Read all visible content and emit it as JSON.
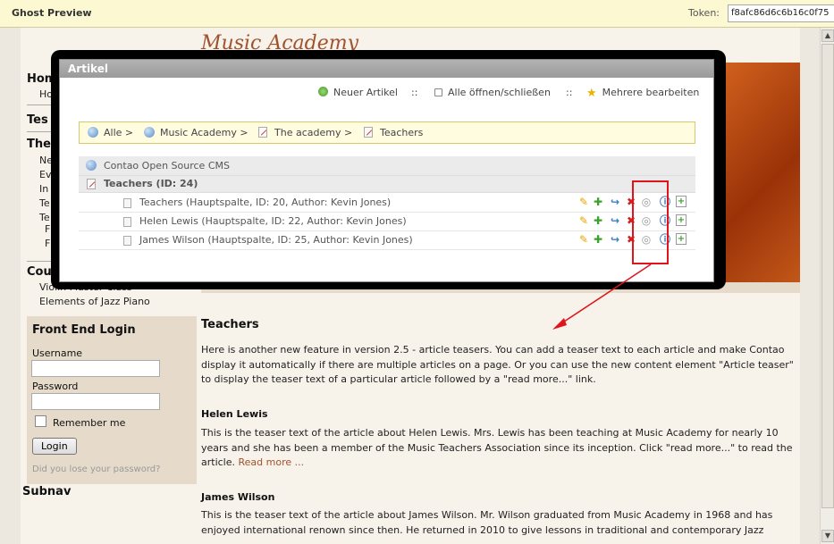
{
  "ghost_bar": {
    "title": "Ghost Preview",
    "token_label": "Token:",
    "token_value": "f8afc86d6c6b16c0f75"
  },
  "site": {
    "logo": "Music Academy"
  },
  "nav": {
    "top_items": [
      {
        "label": "Hom"
      },
      {
        "label": "Tes"
      },
      {
        "label": "The"
      },
      {
        "label": "Cou"
      }
    ],
    "sub_items": [
      "Ho",
      "Ne",
      "Ev",
      "In",
      "Te",
      "Te",
      "F",
      "F"
    ],
    "course_items": [
      "Violin Master Class",
      "Elements of Jazz Piano"
    ]
  },
  "login": {
    "title": "Front End Login",
    "username_label": "Username",
    "password_label": "Password",
    "remember_label": "Remember me",
    "button_label": "Login",
    "lost_password": "Did you lose your password?"
  },
  "subnav": "Subnav",
  "main": {
    "heading": "Teachers",
    "intro": "Here is another new feature in version 2.5 - article teasers. You can add a teaser text to each article and make Contao display it automatically if there are multiple articles on a page. Or you can use the new content element \"Article teaser\" to display the teaser text of a particular article followed by a \"read more...\" link.",
    "articles": [
      {
        "title": "Helen Lewis",
        "text": "This is the teaser text of the article about Helen Lewis. Mrs. Lewis has been teaching at Music Academy for nearly 10 years and she has been a member of the Music Teachers Association since its inception. Click \"read more...\" to read the article.",
        "more": "Read more ..."
      },
      {
        "title": "James Wilson",
        "text": "This is the teaser text of the article about James Wilson. Mr. Wilson graduated from Music Academy in 1968 and has enjoyed international renown since then. He returned in 2010 to give lessons in traditional and contemporary Jazz"
      }
    ]
  },
  "artikel": {
    "title": "Artikel",
    "toolbar": {
      "new": "Neuer Artikel",
      "sep": "::",
      "toggle": "Alle öffnen/schließen",
      "edit_multiple": "Mehrere bearbeiten"
    },
    "breadcrumb": [
      "Alle >",
      "Music Academy >",
      "The academy >",
      "Teachers"
    ],
    "root": "Contao Open Source CMS",
    "page": "Teachers (ID: 24)",
    "rows": [
      "Teachers (Hauptspalte, ID: 20, Author: Kevin Jones)",
      "Helen Lewis (Hauptspalte, ID: 22, Author: Kevin Jones)",
      "James Wilson (Hauptspalte, ID: 25, Author: Kevin Jones)"
    ]
  },
  "colors": {
    "accent": "#a0522d",
    "annotation": "#e0141c"
  }
}
